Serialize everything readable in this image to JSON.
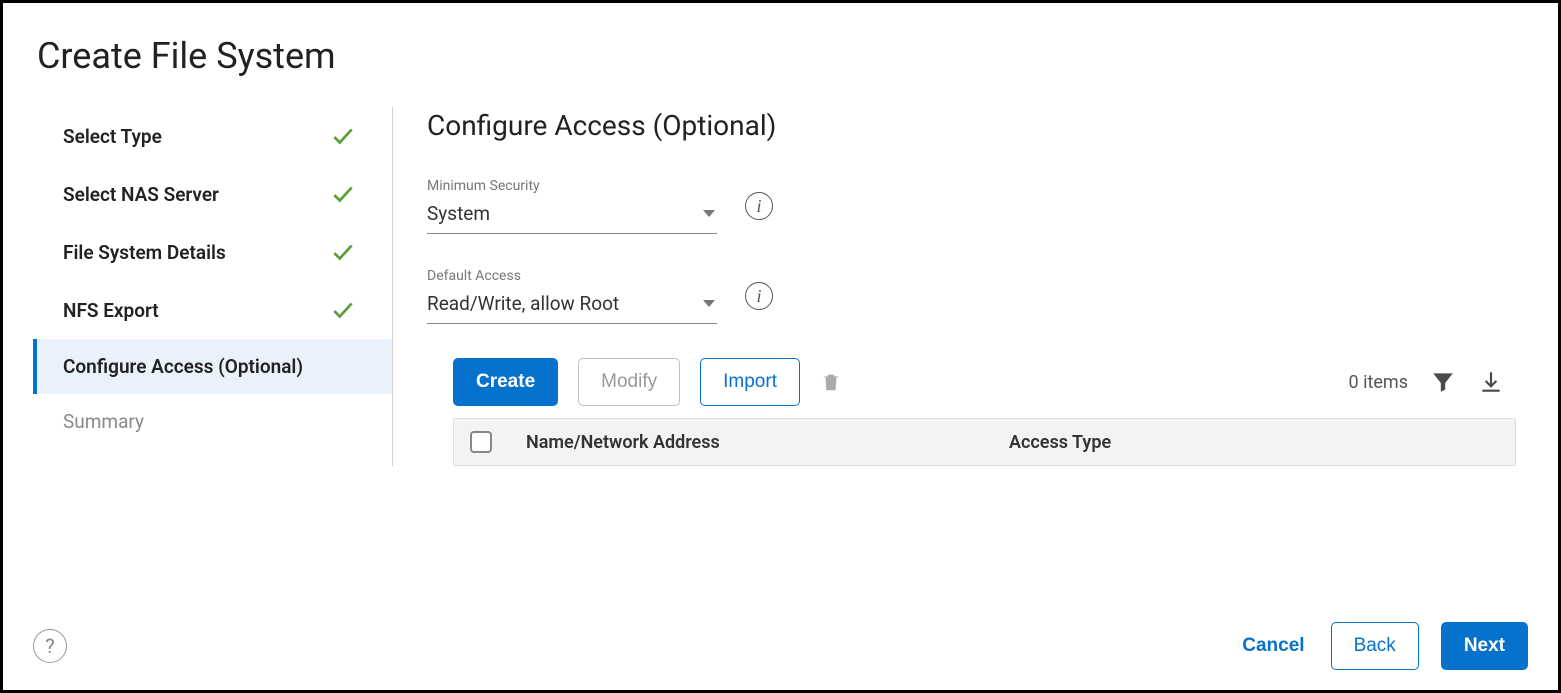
{
  "title": "Create File System",
  "sidebar": {
    "steps": [
      {
        "label": "Select Type",
        "state": "done"
      },
      {
        "label": "Select NAS Server",
        "state": "done"
      },
      {
        "label": "File System Details",
        "state": "done"
      },
      {
        "label": "NFS Export",
        "state": "done"
      },
      {
        "label": "Configure Access (Optional)",
        "state": "active"
      },
      {
        "label": "Summary",
        "state": "pending"
      }
    ]
  },
  "main": {
    "heading": "Configure Access (Optional)",
    "min_security": {
      "label": "Minimum Security",
      "value": "System"
    },
    "default_access": {
      "label": "Default Access",
      "value": "Read/Write, allow Root"
    },
    "toolbar": {
      "create": "Create",
      "modify": "Modify",
      "import": "Import",
      "items_count": "0 items"
    },
    "table": {
      "col_name": "Name/Network Address",
      "col_access": "Access Type",
      "rows": []
    }
  },
  "footer": {
    "cancel": "Cancel",
    "back": "Back",
    "next": "Next"
  }
}
